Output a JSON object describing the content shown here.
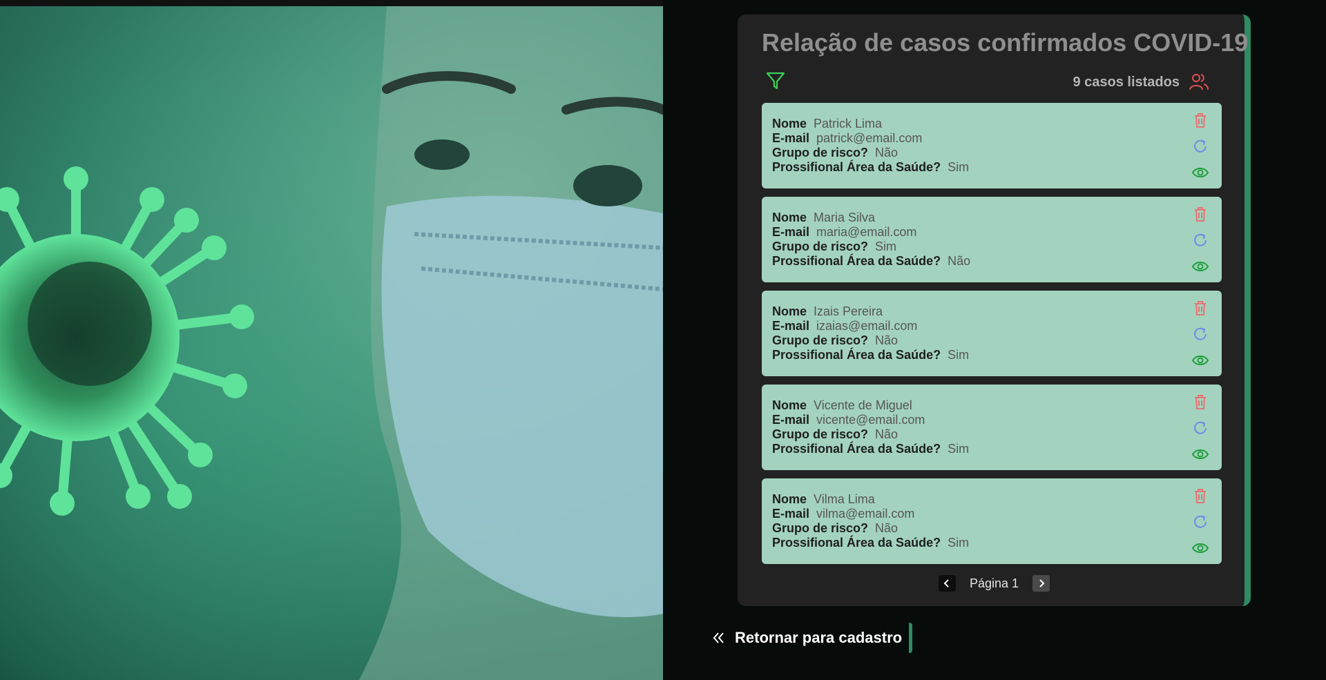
{
  "page": {
    "title": "Relação de casos confirmados COVID-19",
    "count_label": "9 casos listados",
    "filter_icon": "filter-icon",
    "users_icon": "users-icon"
  },
  "colors": {
    "panel_bg": "#222222",
    "card_bg": "#a3d3bf",
    "accent": "#2e8b62",
    "delete": "#e57373",
    "update": "#6b8be8",
    "view": "#1f9e3a"
  },
  "field_labels": {
    "name": "Nome",
    "email": "E-mail",
    "risk": "Grupo de risco?",
    "health": "Prossifional Área da Saúde?"
  },
  "cases": [
    {
      "name": "Patrick Lima",
      "email": "patrick@email.com",
      "risk": "Não",
      "health": "Sim"
    },
    {
      "name": "Maria Silva",
      "email": "maria@email.com",
      "risk": "Sim",
      "health": "Não"
    },
    {
      "name": "Izais Pereira",
      "email": "izaias@email.com",
      "risk": "Não",
      "health": "Sim"
    },
    {
      "name": "Vicente de Miguel",
      "email": "vicente@email.com",
      "risk": "Não",
      "health": "Sim"
    },
    {
      "name": "Vilma Lima",
      "email": "vilma@email.com",
      "risk": "Não",
      "health": "Sim"
    }
  ],
  "pagination": {
    "label": "Página 1"
  },
  "back": {
    "label": "Retornar para cadastro"
  }
}
